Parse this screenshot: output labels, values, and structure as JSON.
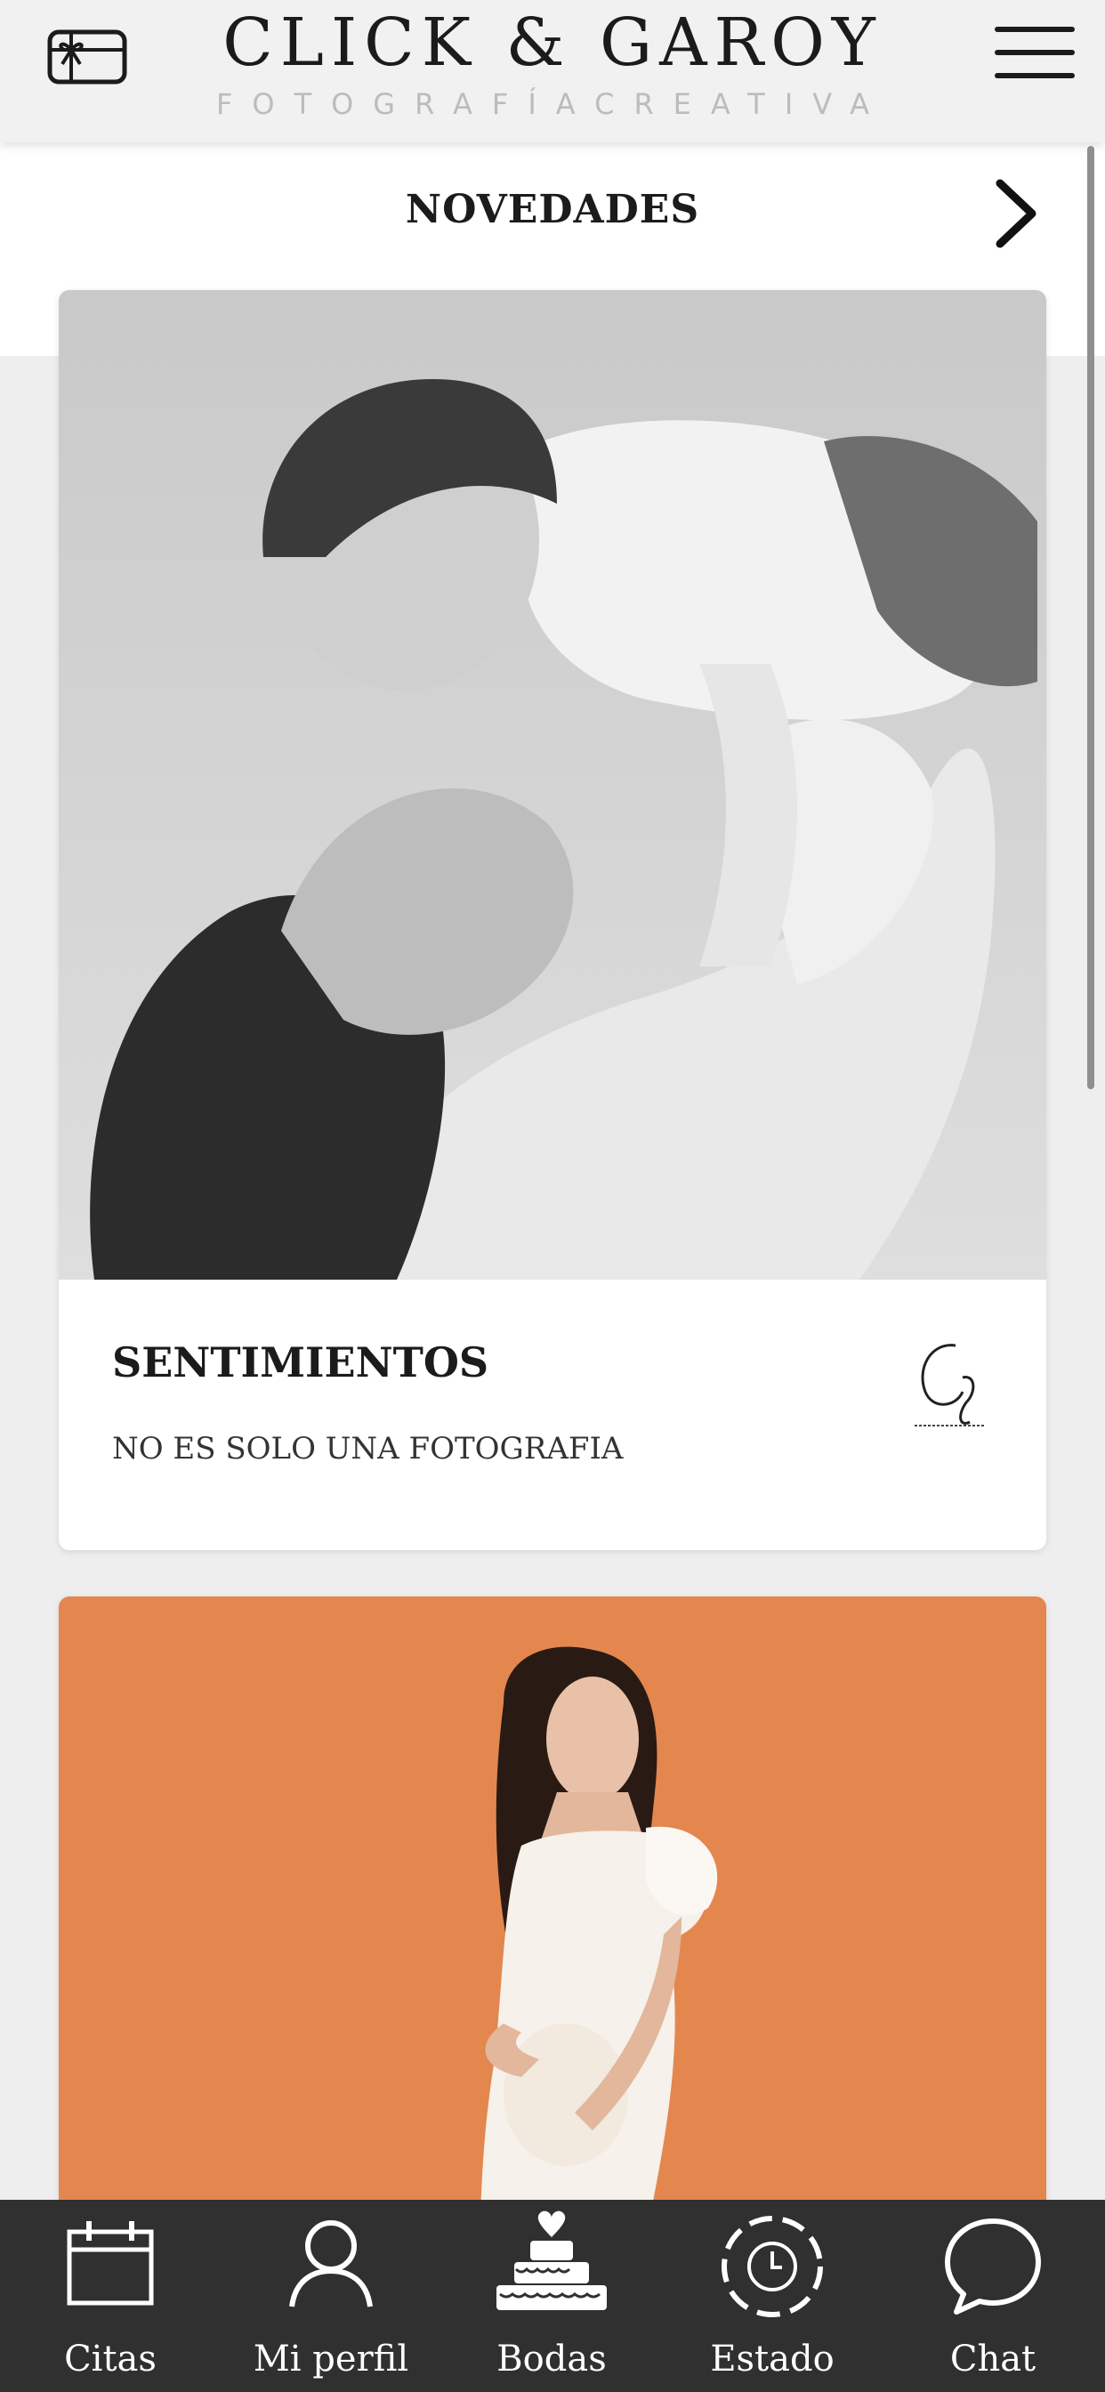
{
  "header": {
    "brand_name": "CLICK & GAROY",
    "tagline": "FOTOGRAFÍACREATIVA",
    "gift_icon": "gift-card-icon",
    "menu_icon": "hamburger-menu-icon"
  },
  "section": {
    "title": "NOVEDADES",
    "more_icon": "chevron-right-icon"
  },
  "cards": [
    {
      "title": "SENTIMIENTOS",
      "subtitle": "NO ES SOLO UNA FOTOGRAFIA",
      "logo_icon": "cg-signature-logo"
    },
    {
      "image_tone": "orange"
    }
  ],
  "nav": {
    "items": [
      {
        "label": "Citas",
        "icon": "calendar-icon"
      },
      {
        "label": "Mi perfil",
        "icon": "user-icon"
      },
      {
        "label": "Bodas",
        "icon": "wedding-cake-icon"
      },
      {
        "label": "Estado",
        "icon": "clock-status-icon"
      },
      {
        "label": "Chat",
        "icon": "chat-bubble-icon"
      }
    ]
  },
  "colors": {
    "header_bg": "#f1f1f1",
    "nav_bg": "#303030",
    "accent_orange": "#e3874f"
  }
}
